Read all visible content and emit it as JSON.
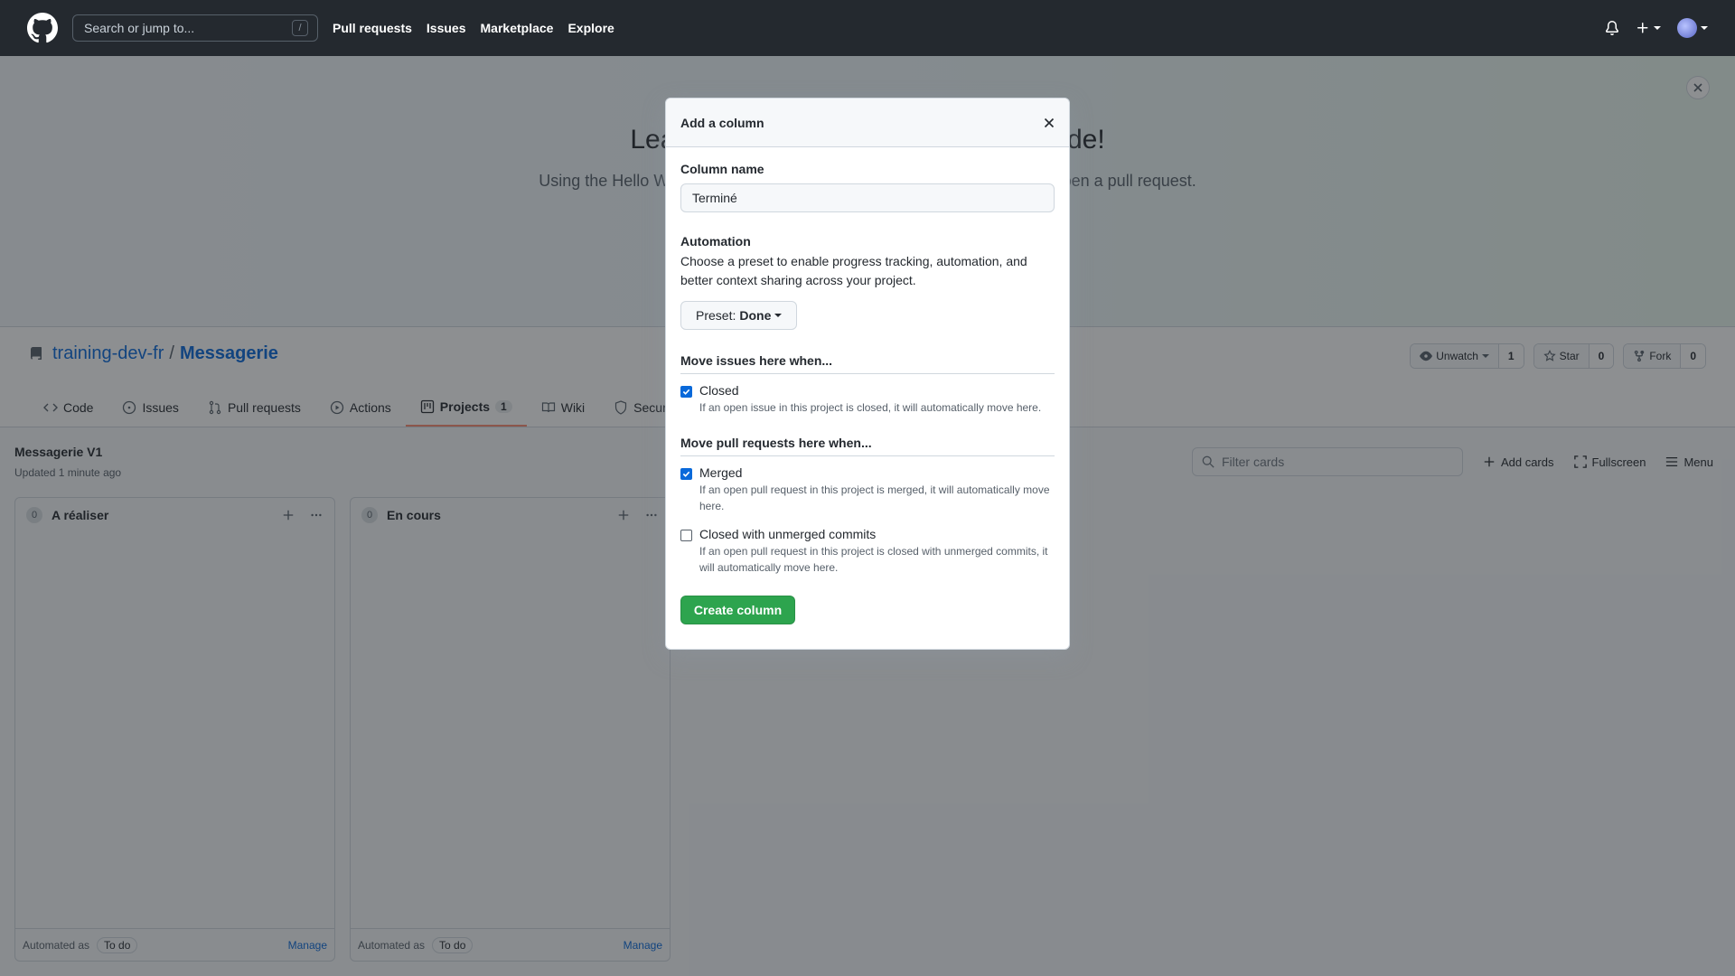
{
  "header": {
    "search_placeholder": "Search or jump to...",
    "search_key": "/",
    "nav": [
      "Pull requests",
      "Issues",
      "Marketplace",
      "Explore"
    ]
  },
  "banner": {
    "title": "Learn Git and GitHub without any code!",
    "subtitle": "Using the Hello World guide, you'll start a branch, write comments, and open a pull request."
  },
  "repo": {
    "owner": "training-dev-fr",
    "separator": "/",
    "name": "Messagerie",
    "watch": {
      "label": "Unwatch",
      "count": "1"
    },
    "star": {
      "label": "Star",
      "count": "0"
    },
    "fork": {
      "label": "Fork",
      "count": "0"
    }
  },
  "tabs": {
    "code": "Code",
    "issues": "Issues",
    "pulls": "Pull requests",
    "actions": "Actions",
    "projects": "Projects",
    "projects_count": "1",
    "wiki": "Wiki",
    "security": "Security"
  },
  "project": {
    "title": "Messagerie V1",
    "updated": "Updated 1 minute ago",
    "filter_placeholder": "Filter cards",
    "add_cards": "Add cards",
    "fullscreen": "Fullscreen",
    "menu": "Menu",
    "columns": [
      {
        "count": "0",
        "name": "A réaliser",
        "automated_as": "Automated as",
        "badge": "To do",
        "manage": "Manage"
      },
      {
        "count": "0",
        "name": "En cours",
        "automated_as": "Automated as",
        "badge": "To do",
        "manage": "Manage"
      }
    ]
  },
  "modal": {
    "title": "Add a column",
    "column_name_label": "Column name",
    "column_name_value": "Terminé",
    "automation_label": "Automation",
    "automation_desc": "Choose a preset to enable progress tracking, automation, and better context sharing across your project.",
    "preset_prefix": "Preset:",
    "preset_value": "Done",
    "issues_section": "Move issues here when...",
    "closed_title": "Closed",
    "closed_note": "If an open issue in this project is closed, it will automatically move here.",
    "prs_section": "Move pull requests here when...",
    "merged_title": "Merged",
    "merged_note": "If an open pull request in this project is merged, it will automatically move here.",
    "unmerged_title": "Closed with unmerged commits",
    "unmerged_note": "If an open pull request in this project is closed with unmerged commits, it will automatically move here.",
    "create_button": "Create column"
  },
  "colors": {
    "header_bg": "#24292f",
    "primary_green": "#2da44e",
    "link_blue": "#0969da",
    "tab_accent": "#fd8c73"
  }
}
